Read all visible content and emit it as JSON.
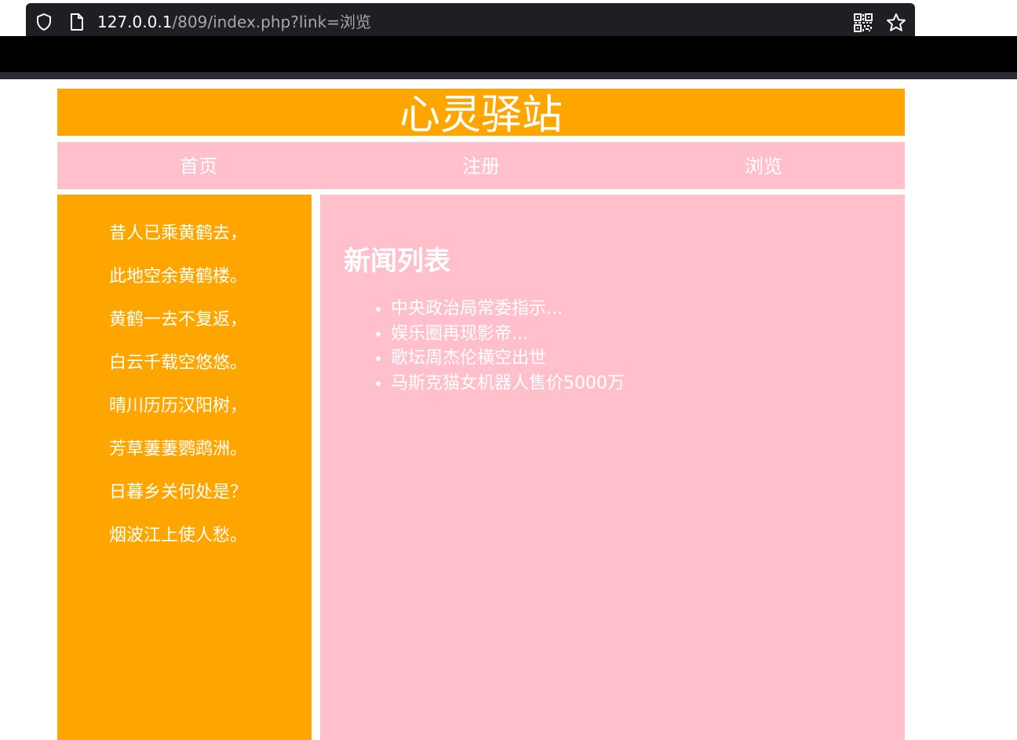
{
  "browser": {
    "url_host": "127.0.0.1",
    "url_path": "/809/index.php?link=浏览",
    "icons": [
      "shield-icon",
      "page-icon",
      "qr-code-icon",
      "star-icon"
    ]
  },
  "header": {
    "title": "心灵驿站"
  },
  "nav": {
    "items": [
      {
        "label": "首页"
      },
      {
        "label": "注册"
      },
      {
        "label": "浏览"
      }
    ]
  },
  "sidebar": {
    "poem_lines": [
      "昔人已乘黄鹤去，",
      "此地空余黄鹤楼。",
      "黄鹤一去不复返，",
      "白云千载空悠悠。",
      "晴川历历汉阳树，",
      "芳草萋萋鹦鹉洲。",
      "日暮乡关何处是？",
      "烟波江上使人愁。"
    ]
  },
  "main": {
    "heading": "新闻列表",
    "news": [
      "中央政治局常委指示...",
      "娱乐圈再现影帝...",
      "歌坛周杰伦横空出世",
      "马斯克猫女机器人售价5000万"
    ]
  },
  "colors": {
    "header_bg": "#ffa500",
    "nav_bg": "#ffc0cb",
    "sidebar_bg": "#ffa500",
    "main_bg": "#ffc0cb",
    "text": "#ffffff"
  }
}
